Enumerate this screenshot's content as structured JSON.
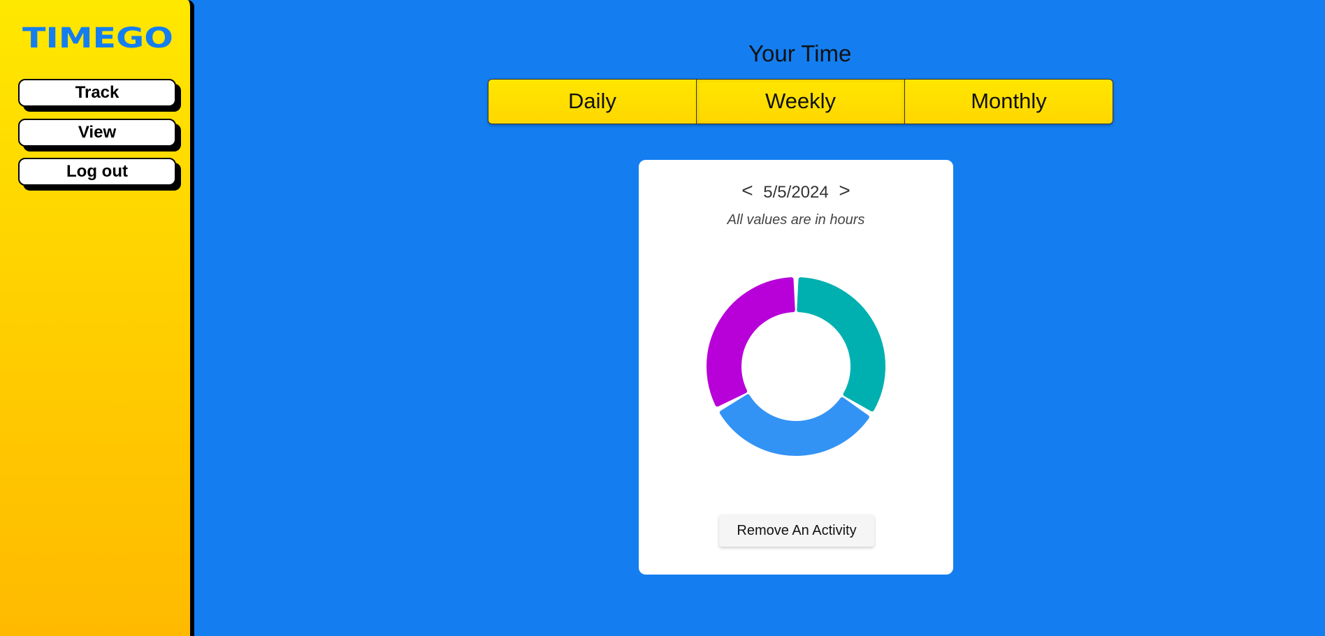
{
  "brand": {
    "logo_text": "TIMEGO",
    "logo_color": "#147ef0"
  },
  "sidebar": {
    "items": [
      {
        "label": "Track"
      },
      {
        "label": "View"
      },
      {
        "label": "Log out"
      }
    ]
  },
  "main": {
    "title": "Your Time",
    "tabs": [
      {
        "label": "Daily"
      },
      {
        "label": "Weekly"
      },
      {
        "label": "Monthly"
      }
    ],
    "card": {
      "prev_symbol": "<",
      "date": "5/5/2024",
      "next_symbol": ">",
      "note": "All values are in hours",
      "remove_button": "Remove An Activity"
    }
  },
  "colors": {
    "background": "#147ef0",
    "sidebar_gradient_top": "#ffe800",
    "sidebar_gradient_bottom": "#ffba00",
    "tab_yellow": "#ffe000"
  },
  "chart_data": {
    "type": "pie",
    "style": "donut",
    "values": [
      34,
      33,
      33
    ],
    "colors": [
      "#00b0b0",
      "#3393f5",
      "#b800d8"
    ]
  }
}
